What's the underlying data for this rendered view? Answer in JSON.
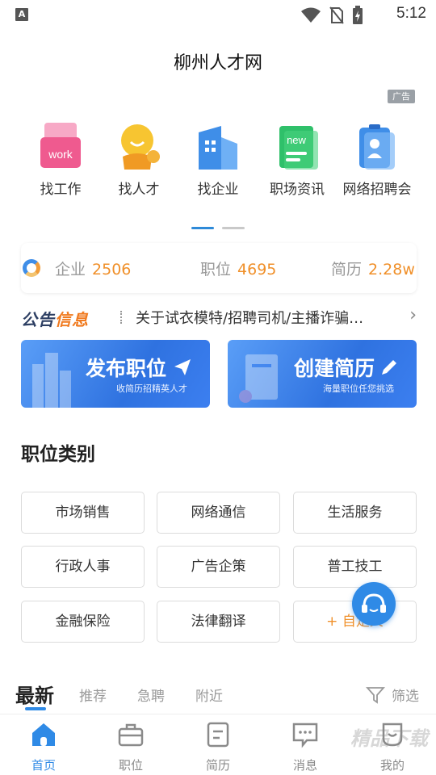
{
  "status_bar": {
    "time": "5:12",
    "notification_icon": "a-icon",
    "icons": [
      "wifi-icon",
      "no-sim-icon",
      "battery-charging-icon"
    ]
  },
  "app_title": "柳州人才网",
  "ad_label": "广告",
  "quick_menu": [
    {
      "label": "找工作",
      "icon": "find-job-icon",
      "badge": "work"
    },
    {
      "label": "找人才",
      "icon": "find-talent-icon"
    },
    {
      "label": "找企业",
      "icon": "find-company-icon"
    },
    {
      "label": "职场资讯",
      "icon": "workplace-news-icon",
      "badge": "new"
    },
    {
      "label": "网络招聘会",
      "icon": "online-job-fair-icon"
    }
  ],
  "pager": {
    "pages": 2,
    "active": 0
  },
  "stats": [
    {
      "label": "企业",
      "value": "2506"
    },
    {
      "label": "职位",
      "value": "4695"
    },
    {
      "label": "简历",
      "value": "2.28w"
    }
  ],
  "notice": {
    "logo_part1": "公告",
    "logo_part2": "信息",
    "text": "关于试衣模特/招聘司机/主播诈骗…"
  },
  "banners": [
    {
      "title": "发布职位",
      "subtitle": "收简历招精英人才",
      "icon": "send-icon"
    },
    {
      "title": "创建简历",
      "subtitle": "海量职位任您挑选",
      "icon": "edit-icon"
    }
  ],
  "category_section_title": "职位类别",
  "categories": [
    "市场销售",
    "网络通信",
    "生活服务",
    "行政人事",
    "广告企策",
    "普工技工",
    "金融保险",
    "法律翻译",
    "+ 自定义"
  ],
  "tabs": [
    "最新",
    "推荐",
    "急聘",
    "附近"
  ],
  "active_tab": 0,
  "filter_label": "筛选",
  "bottom_nav": [
    {
      "label": "首页",
      "icon": "home-icon",
      "active": true
    },
    {
      "label": "职位",
      "icon": "briefcase-icon"
    },
    {
      "label": "简历",
      "icon": "resume-icon"
    },
    {
      "label": "消息",
      "icon": "message-icon"
    },
    {
      "label": "我的",
      "icon": "profile-icon"
    }
  ],
  "watermark": "精品下载",
  "colors": {
    "accent": "#2f8ae6",
    "stat_number": "#f0902a",
    "banner_blue": "#2f72e0"
  }
}
